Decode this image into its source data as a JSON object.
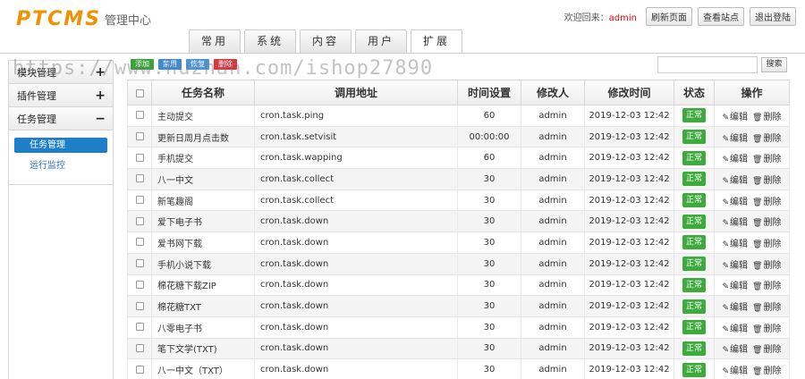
{
  "header": {
    "logo": "PTCMS",
    "logo_sub": "管理中心",
    "welcome_prefix": "欢迎回来：",
    "username": "admin",
    "buttons": [
      "刷新页面",
      "查看站点",
      "退出登陆"
    ]
  },
  "tabs": [
    {
      "label": "常用",
      "active": false
    },
    {
      "label": "系统",
      "active": false
    },
    {
      "label": "内容",
      "active": false
    },
    {
      "label": "用户",
      "active": false
    },
    {
      "label": "扩展",
      "active": true
    }
  ],
  "sidebar": {
    "groups": [
      {
        "label": "模块管理",
        "sign": "+"
      },
      {
        "label": "插件管理",
        "sign": "+"
      },
      {
        "label": "任务管理",
        "sign": "−"
      }
    ],
    "items": [
      {
        "label": "任务管理",
        "active": true
      },
      {
        "label": "运行监控",
        "active": false
      }
    ]
  },
  "toolbar": {
    "add": "添加",
    "disable": "禁用",
    "restore": "恢复",
    "delete": "删除",
    "search_button": "搜索",
    "search_value": ""
  },
  "table": {
    "headers": [
      "任务名称",
      "调用地址",
      "时间设置",
      "修改人",
      "修改时间",
      "状态",
      "操作"
    ],
    "edit_label": "编辑",
    "delete_label": "删除",
    "rows": [
      {
        "name": "主动提交",
        "url": "cron.task.ping",
        "time": "60",
        "user": "admin",
        "modified": "2019-12-03 12:42",
        "status": "正常"
      },
      {
        "name": "更新日周月点击数",
        "url": "cron.task.setvisit",
        "time": "00:00:00",
        "user": "admin",
        "modified": "2019-12-03 12:42",
        "status": "正常"
      },
      {
        "name": "手机提交",
        "url": "cron.task.wapping",
        "time": "60",
        "user": "admin",
        "modified": "2019-12-03 12:42",
        "status": "正常"
      },
      {
        "name": "八一中文",
        "url": "cron.task.collect",
        "time": "30",
        "user": "admin",
        "modified": "2019-12-03 12:42",
        "status": "正常"
      },
      {
        "name": "新笔趣阁",
        "url": "cron.task.collect",
        "time": "30",
        "user": "admin",
        "modified": "2019-12-03 12:42",
        "status": "正常"
      },
      {
        "name": "爱下电子书",
        "url": "cron.task.down",
        "time": "30",
        "user": "admin",
        "modified": "2019-12-03 12:42",
        "status": "正常"
      },
      {
        "name": "爱书网下载",
        "url": "cron.task.down",
        "time": "30",
        "user": "admin",
        "modified": "2019-12-03 12:42",
        "status": "正常"
      },
      {
        "name": "手机小说下载",
        "url": "cron.task.down",
        "time": "30",
        "user": "admin",
        "modified": "2019-12-03 12:42",
        "status": "正常"
      },
      {
        "name": "棉花糖下载ZIP",
        "url": "cron.task.down",
        "time": "30",
        "user": "admin",
        "modified": "2019-12-03 12:42",
        "status": "正常"
      },
      {
        "name": "棉花糖TXT",
        "url": "cron.task.down",
        "time": "30",
        "user": "admin",
        "modified": "2019-12-03 12:42",
        "status": "正常"
      },
      {
        "name": "八零电子书",
        "url": "cron.task.down",
        "time": "30",
        "user": "admin",
        "modified": "2019-12-03 12:42",
        "status": "正常"
      },
      {
        "name": "笔下文学(TXT)",
        "url": "cron.task.down",
        "time": "30",
        "user": "admin",
        "modified": "2019-12-03 12:42",
        "status": "正常"
      },
      {
        "name": "八一中文（TXT）",
        "url": "cron.task.down",
        "time": "30",
        "user": "admin",
        "modified": "2019-12-03 12:42",
        "status": "正常"
      }
    ]
  },
  "watermark": "https://www.huzhan.com/ishop27890",
  "colors": {
    "brand": "#f29100",
    "status_ok": "#3cab3c",
    "accent": "#1f7ec8",
    "danger": "#d9363e"
  }
}
